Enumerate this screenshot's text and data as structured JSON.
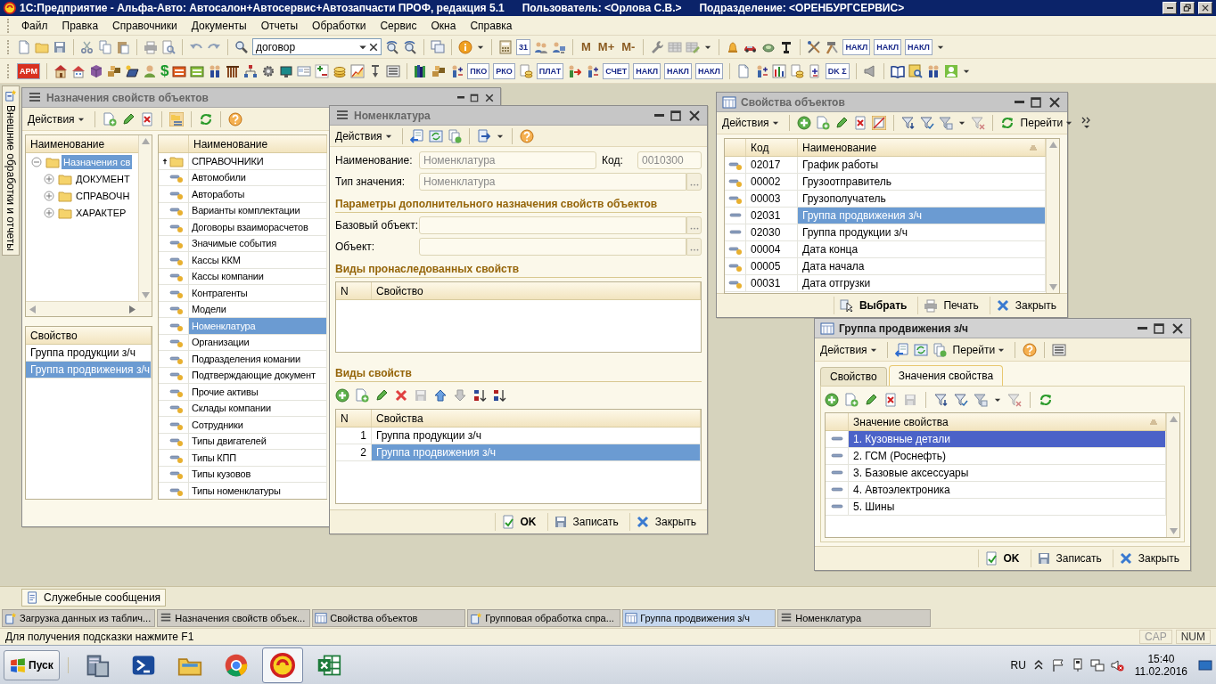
{
  "app_title": "1С:Предприятие - Альфа-Авто: Автосалон+Автосервис+Автозапчасти ПРОФ, редакция 5.1",
  "user": "Пользователь: <Орлова С.В.>",
  "department": "Подразделение: <ОРЕНБУРГСЕРВИС>",
  "menu": [
    "Файл",
    "Правка",
    "Справочники",
    "Документы",
    "Отчеты",
    "Обработки",
    "Сервис",
    "Окна",
    "Справка"
  ],
  "toolbar_1": {
    "search_value": "договор",
    "memory_buttons": [
      "M",
      "M+",
      "M-"
    ],
    "shortcuts": [
      "31",
      "НАКЛ",
      "НАКЛ",
      "НАКЛ"
    ]
  },
  "toolbar_2": {
    "currency": "$",
    "shortcuts": [
      "АРМ",
      "ПКО",
      "РКО",
      "ПЛАТ",
      "СЧЕТ",
      "НАКЛ",
      "НАКЛ",
      "НАКЛ",
      "DK Σ"
    ]
  },
  "side_panel": "Внешние обработки и отчеты",
  "assignments_window": {
    "title": "Назначения свойств объектов",
    "active": false,
    "actions": "Действия",
    "tree": {
      "header": "Наименование",
      "items": [
        {
          "label": "Назначения св",
          "selected": true,
          "expanded": true,
          "children": [
            {
              "label": "ДОКУМЕНТ",
              "selected": false,
              "expanded": false
            },
            {
              "label": "СПРАВОЧН",
              "selected": false,
              "expanded": false
            },
            {
              "label": "ХАРАКТЕР",
              "selected": false,
              "expanded": false
            }
          ]
        }
      ]
    },
    "properties": {
      "header": "Свойство",
      "rows": [
        {
          "label": "Группа продукции з/ч",
          "selected": false
        },
        {
          "label": "Группа продвижения з/ч",
          "selected": true
        }
      ]
    },
    "objects": {
      "header": "Наименование",
      "rows": [
        {
          "label": "СПРАВОЧНИКИ",
          "kind": "folder",
          "selected": false
        },
        {
          "label": "Автомобили",
          "kind": "item",
          "selected": false
        },
        {
          "label": "Автоработы",
          "kind": "item",
          "selected": false
        },
        {
          "label": "Варианты комплектации",
          "kind": "item",
          "selected": false
        },
        {
          "label": "Договоры взаиморасчетов",
          "kind": "item",
          "selected": false
        },
        {
          "label": "Значимые события",
          "kind": "item",
          "selected": false
        },
        {
          "label": "Кассы ККМ",
          "kind": "item",
          "selected": false
        },
        {
          "label": "Кассы компании",
          "kind": "item",
          "selected": false
        },
        {
          "label": "Контрагенты",
          "kind": "item",
          "selected": false
        },
        {
          "label": "Модели",
          "kind": "item",
          "selected": false
        },
        {
          "label": "Номенклатура",
          "kind": "item",
          "selected": true
        },
        {
          "label": "Организации",
          "kind": "item",
          "selected": false
        },
        {
          "label": "Подразделения комании",
          "kind": "item",
          "selected": false
        },
        {
          "label": "Подтверждающие документ",
          "kind": "item",
          "selected": false
        },
        {
          "label": "Прочие активы",
          "kind": "item",
          "selected": false
        },
        {
          "label": "Склады компании",
          "kind": "item",
          "selected": false
        },
        {
          "label": "Сотрудники",
          "kind": "item",
          "selected": false
        },
        {
          "label": "Типы двигателей",
          "kind": "item",
          "selected": false
        },
        {
          "label": "Типы КПП",
          "kind": "item",
          "selected": false
        },
        {
          "label": "Типы кузовов",
          "kind": "item",
          "selected": false
        },
        {
          "label": "Типы номенклатуры",
          "kind": "item",
          "selected": false
        }
      ]
    }
  },
  "nomenclature_window": {
    "title": "Номенклатура",
    "active": false,
    "actions": "Действия",
    "name_field": {
      "label": "Наименование:",
      "value": "Номенклатура"
    },
    "code_field": {
      "label": "Код:",
      "value": "0010300"
    },
    "type_field": {
      "label": "Тип значения:",
      "value": "Номенклатура"
    },
    "params_section": "Параметры дополнительного назначения свойств объектов",
    "base_fields": [
      {
        "label": "Базовый объект:"
      },
      {
        "label": "Объект:"
      }
    ],
    "inherited_section": "Виды пронаследованных свойств",
    "inherited_table": {
      "columns": [
        "N",
        "Свойство"
      ]
    },
    "kinds_section": "Виды свойств",
    "kinds_table": {
      "columns": [
        "N",
        "Свойства"
      ],
      "rows": [
        {
          "n": "1",
          "label": "Группа продукции з/ч",
          "selected": false
        },
        {
          "n": "2",
          "label": "Группа продвижения з/ч",
          "selected": true
        }
      ]
    },
    "buttons": [
      {
        "label": "OK",
        "kind": "ok"
      },
      {
        "label": "Записать",
        "kind": "save"
      },
      {
        "label": "Закрыть",
        "kind": "close"
      }
    ]
  },
  "properties_window": {
    "title": "Свойства объектов",
    "active": false,
    "actions": "Действия",
    "goto": "Перейти",
    "columns": [
      "Код",
      "Наименование"
    ],
    "rows": [
      {
        "code": "02017",
        "name": "График работы",
        "kind": "dotted",
        "selected": false
      },
      {
        "code": "00002",
        "name": "Грузоотправитель",
        "kind": "dotted",
        "selected": false
      },
      {
        "code": "00003",
        "name": "Грузополучатель",
        "kind": "dotted",
        "selected": false
      },
      {
        "code": "02031",
        "name": "Группа продвижения з/ч",
        "kind": "plain",
        "selected": true
      },
      {
        "code": "02030",
        "name": "Группа продукции з/ч",
        "kind": "plain",
        "selected": false
      },
      {
        "code": "00004",
        "name": "Дата конца",
        "kind": "dotted",
        "selected": false
      },
      {
        "code": "00005",
        "name": "Дата начала",
        "kind": "dotted",
        "selected": false
      },
      {
        "code": "00031",
        "name": "Дата отгрузки",
        "kind": "dotted",
        "selected": false
      }
    ],
    "buttons": [
      {
        "label": "Выбрать",
        "kind": "select"
      },
      {
        "label": "Печать",
        "kind": "print"
      },
      {
        "label": "Закрыть",
        "kind": "close"
      }
    ]
  },
  "promo_group_window": {
    "title": "Группа продвижения з/ч",
    "active": true,
    "actions": "Действия",
    "goto": "Перейти",
    "tabs": [
      {
        "label": "Свойство",
        "selected": false
      },
      {
        "label": "Значения свойства",
        "selected": true
      }
    ],
    "column": "Значение свойства",
    "rows": [
      {
        "label": "1. Кузовные детали",
        "selected": true
      },
      {
        "label": "2. ГСМ (Роснефть)",
        "selected": false
      },
      {
        "label": "3. Базовые аксессуары",
        "selected": false
      },
      {
        "label": "4. Автоэлектроника",
        "selected": false
      },
      {
        "label": "5. Шины",
        "selected": false
      }
    ],
    "buttons": [
      {
        "label": "OK",
        "kind": "ok"
      },
      {
        "label": "Записать",
        "kind": "save"
      },
      {
        "label": "Закрыть",
        "kind": "close"
      }
    ]
  },
  "service_messages": "Служебные сообщения",
  "window_tabs": [
    {
      "label": "Загрузка данных из таблич...",
      "kind": "processing",
      "selected": false
    },
    {
      "label": "Назначения свойств объек...",
      "kind": "list",
      "selected": false
    },
    {
      "label": "Свойства объектов",
      "kind": "table",
      "selected": false
    },
    {
      "label": "Групповая обработка спра...",
      "kind": "processing",
      "selected": false
    },
    {
      "label": "Группа продвижения з/ч",
      "kind": "table",
      "selected": true
    },
    {
      "label": "Номенклатура",
      "kind": "list",
      "selected": false
    }
  ],
  "status": {
    "hint": "Для получения подсказки нажмите F1",
    "indicators": [
      "CAP",
      "NUM"
    ]
  },
  "taskbar": {
    "start": "Пуск",
    "apps": [
      {
        "selected": false
      },
      {
        "selected": false
      },
      {
        "selected": false
      },
      {
        "selected": false
      },
      {
        "selected": true
      },
      {
        "selected": false
      }
    ],
    "language": "RU",
    "time": "15:40",
    "date": "11.02.2016"
  }
}
